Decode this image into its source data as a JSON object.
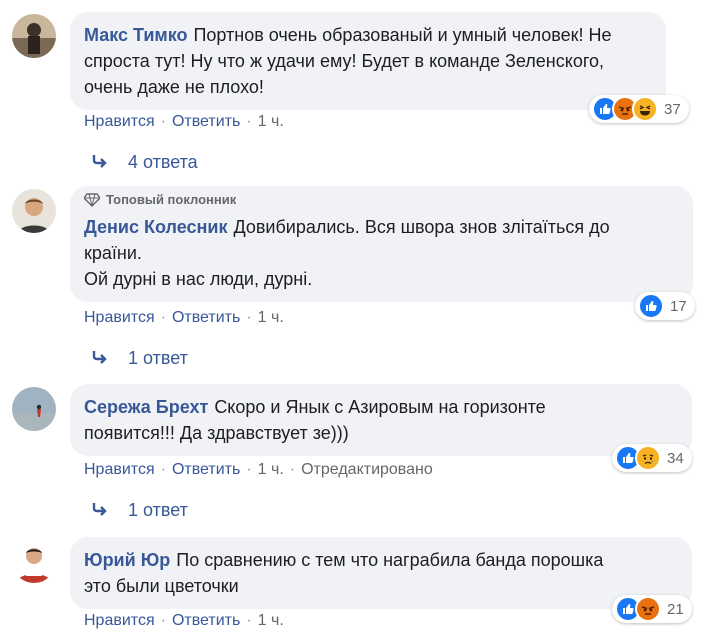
{
  "comments": [
    {
      "author": "Макс Тимко",
      "text_line1": "Портнов очень образованый и умный человек! Не",
      "text_line2": "спроста тут! Ну что ж удачи ему! Будет в команде Зеленского,",
      "text_line3": "очень даже не плохо!",
      "like": "Нравится",
      "reply": "Ответить",
      "time": "1 ч.",
      "reaction_count": "37",
      "reaction_icons": [
        "like-icon",
        "angry-icon",
        "haha-icon"
      ],
      "replies": "4 ответа"
    },
    {
      "badge": "Топовый поклонник",
      "author": "Денис Колесник",
      "text_line1": "Довибирались. Вся швора знов злітаїться до",
      "text_line2": "країни.",
      "text_line3": "Ой дурні в нас люди, дурні.",
      "like": "Нравится",
      "reply": "Ответить",
      "time": "1 ч.",
      "reaction_count": "17",
      "reaction_icons": [
        "like-icon"
      ],
      "replies": "1 ответ"
    },
    {
      "author": "Сережа Брехт",
      "text_line1": "Скоро и Янык с Азировым на горизонте",
      "text_line2": "появится!!! Да здравствует зе)))",
      "like": "Нравится",
      "reply": "Ответить",
      "time": "1 ч.",
      "edited": "Отредактировано",
      "reaction_count": "34",
      "reaction_icons": [
        "like-icon",
        "sad-icon"
      ],
      "replies": "1 ответ"
    },
    {
      "author": "Юрий Юр",
      "text_line1": "По сравнению с тем что награбила банда порошка",
      "text_line2": "это были цветочки",
      "like": "Нравится",
      "reply": "Ответить",
      "time": "1 ч.",
      "reaction_count": "21",
      "reaction_icons": [
        "like-icon",
        "angry-icon"
      ]
    }
  ],
  "colors": {
    "link": "#385898",
    "bubble": "#f0f2f5",
    "meta": "#65676b",
    "like_blue": "#1877f2",
    "angry": "#e9710f",
    "haha": "#f7b125"
  }
}
